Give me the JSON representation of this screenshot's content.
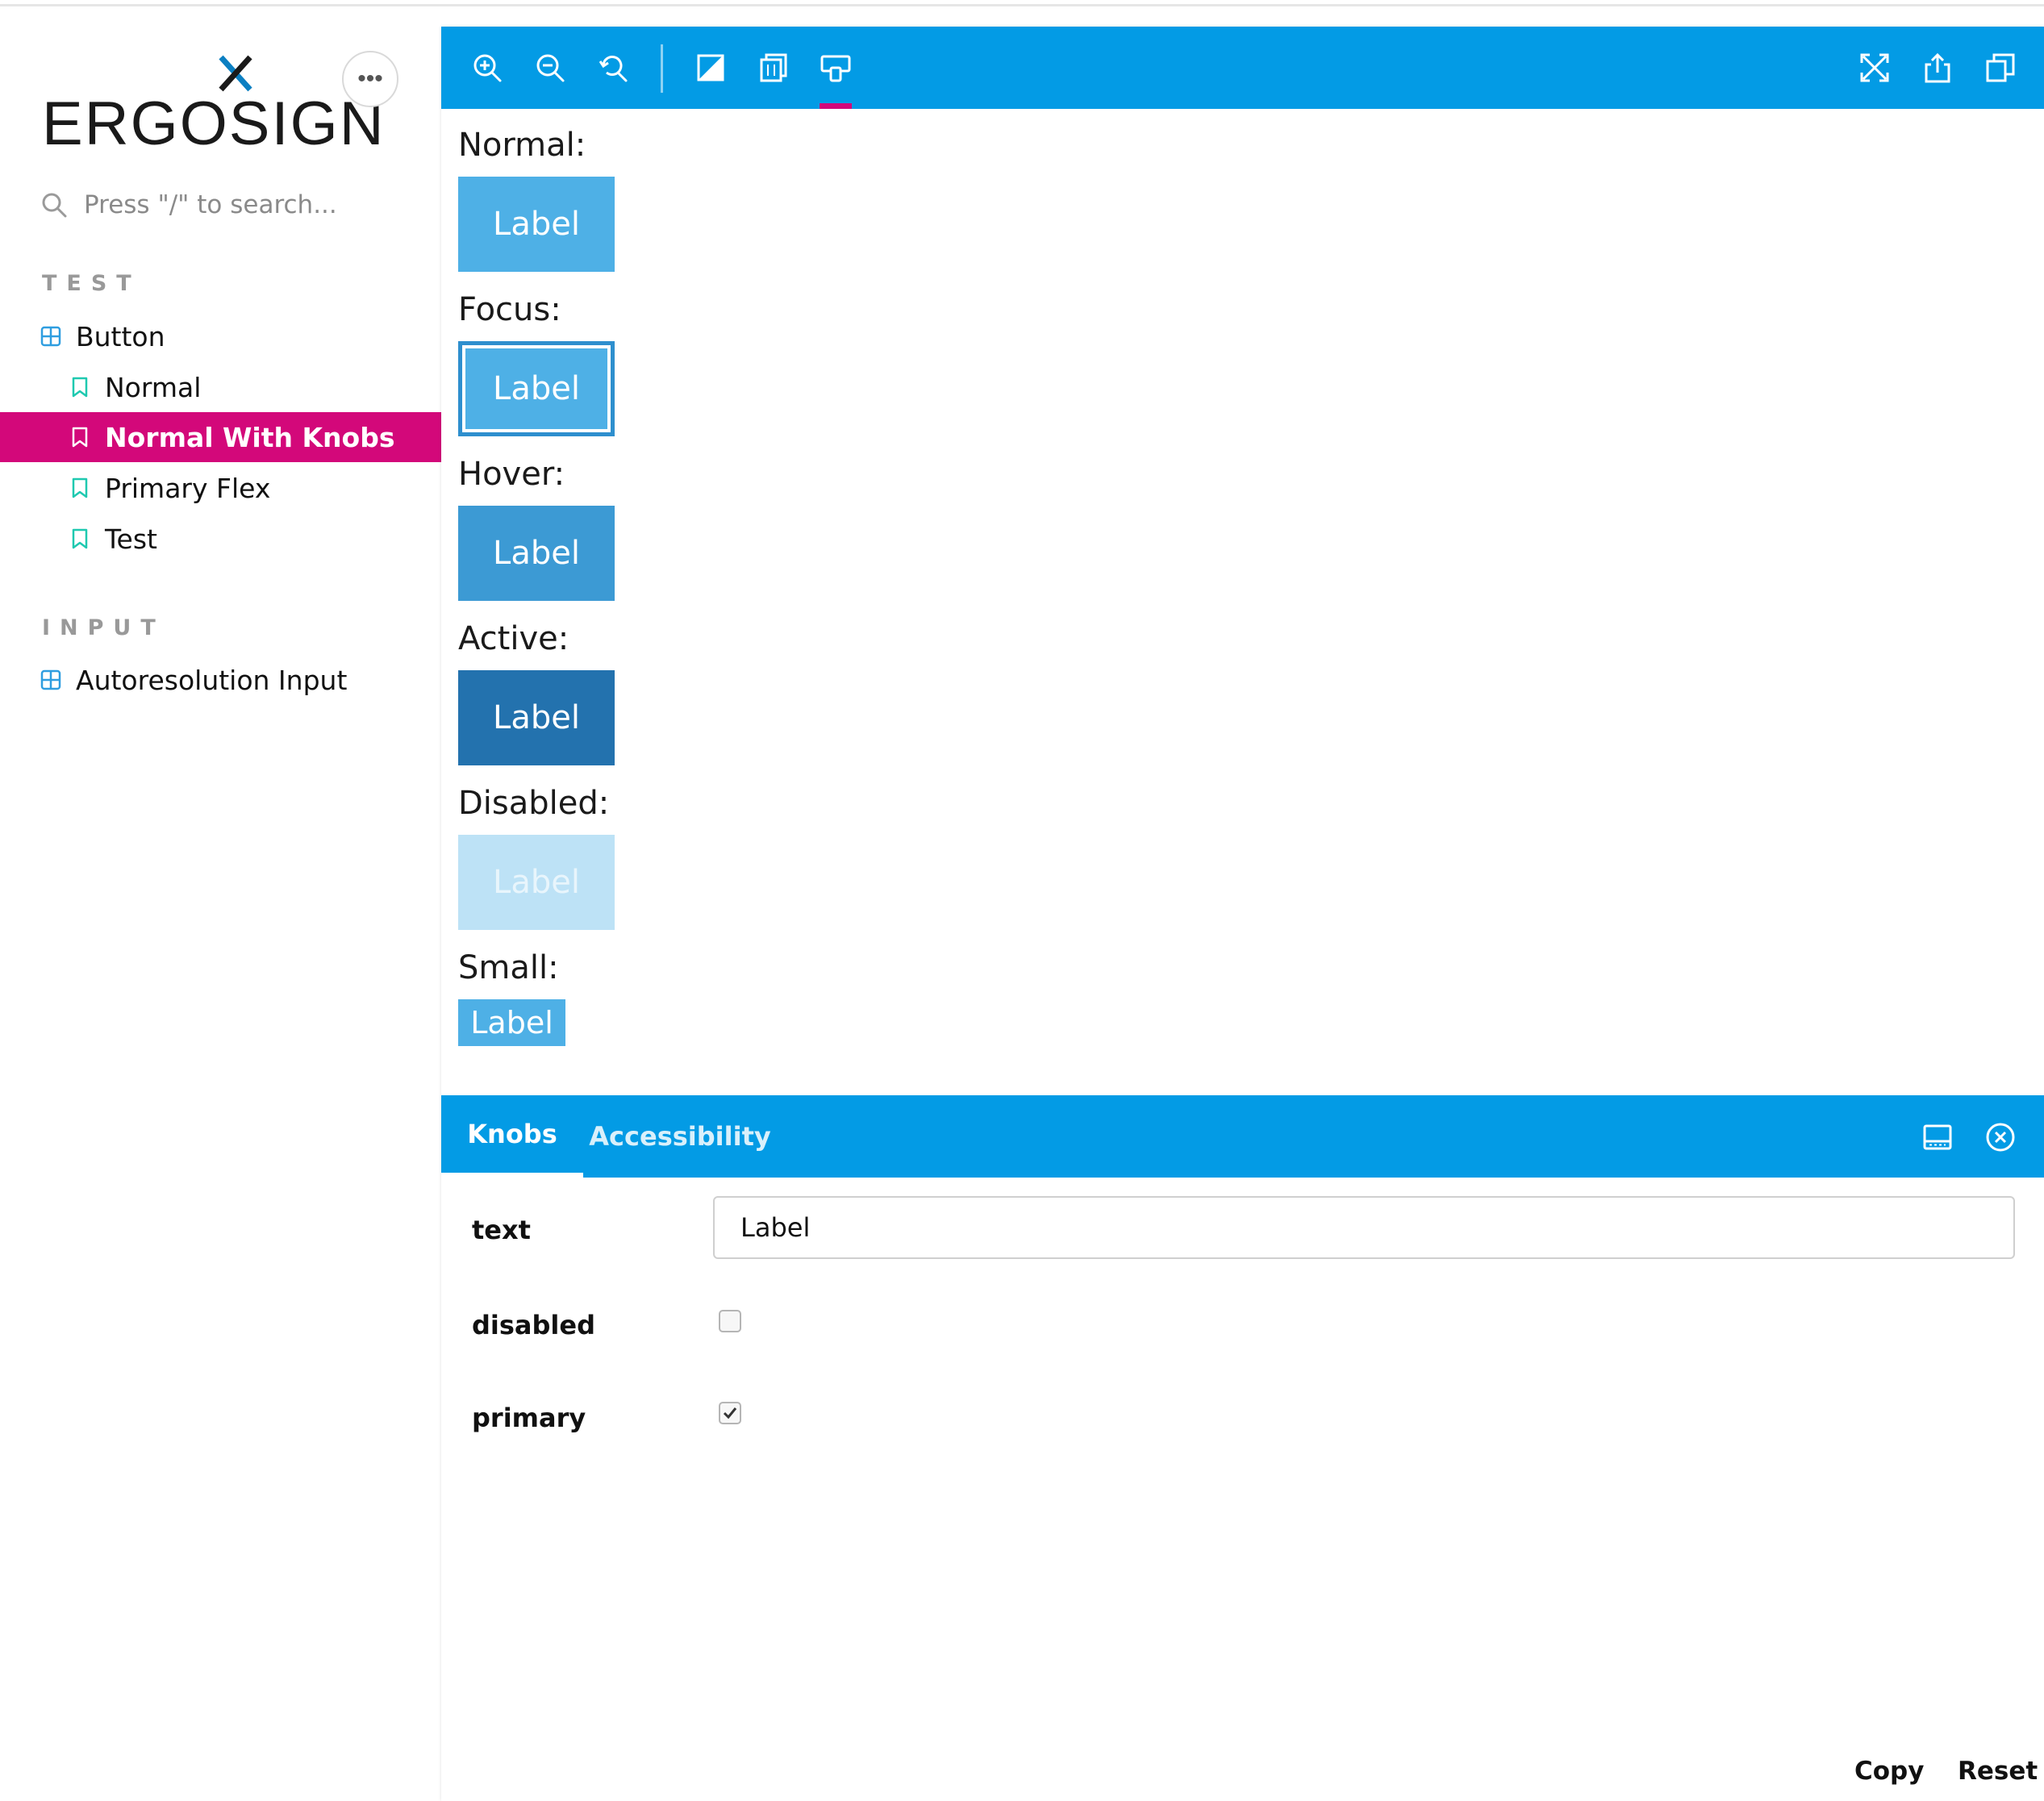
{
  "brand": {
    "logo_text": "ERGOSIGN",
    "accent_color": "#039be5",
    "selection_color": "#d3087a",
    "logo_x_color": "#0b7fc2"
  },
  "sidebar": {
    "more_label": "•••",
    "search_placeholder": "Press \"/\" to search...",
    "sections": [
      {
        "title": "TEST",
        "items": [
          {
            "label": "Button",
            "kind": "component",
            "icon": "component-grid-icon"
          },
          {
            "label": "Normal",
            "kind": "story",
            "icon": "bookmark-icon"
          },
          {
            "label": "Normal With Knobs",
            "kind": "story",
            "icon": "bookmark-icon",
            "selected": true
          },
          {
            "label": "Primary Flex",
            "kind": "story",
            "icon": "bookmark-icon"
          },
          {
            "label": "Test",
            "kind": "story",
            "icon": "bookmark-icon"
          }
        ]
      },
      {
        "title": "INPUT",
        "items": [
          {
            "label": "Autoresolution Input",
            "kind": "component",
            "icon": "component-grid-icon"
          }
        ]
      }
    ]
  },
  "toolbar": {
    "left_icons": [
      "zoom-in-icon",
      "zoom-out-icon",
      "reset-zoom-icon",
      "background-icon",
      "grid-icon",
      "viewport-icon"
    ],
    "right_icons": [
      "fullscreen-icon",
      "share-icon",
      "copy-link-icon"
    ],
    "active_icon": "viewport-icon"
  },
  "preview": {
    "states": [
      {
        "label": "Normal:",
        "button": "Label"
      },
      {
        "label": "Focus:",
        "button": "Label"
      },
      {
        "label": "Hover:",
        "button": "Label"
      },
      {
        "label": "Active:",
        "button": "Label"
      },
      {
        "label": "Disabled:",
        "button": "Label"
      },
      {
        "label": "Small:",
        "button": "Label"
      }
    ]
  },
  "addons": {
    "tabs": [
      {
        "label": "Knobs",
        "active": true
      },
      {
        "label": "Accessibility",
        "active": false
      }
    ],
    "right_icons": [
      "panel-orientation-icon",
      "close-panel-icon"
    ],
    "knobs": {
      "text": {
        "label": "text",
        "value": "Label"
      },
      "disabled": {
        "label": "disabled",
        "checked": false
      },
      "primary": {
        "label": "primary",
        "checked": true
      }
    },
    "footer": {
      "copy_label": "Copy",
      "reset_label": "Reset"
    }
  }
}
